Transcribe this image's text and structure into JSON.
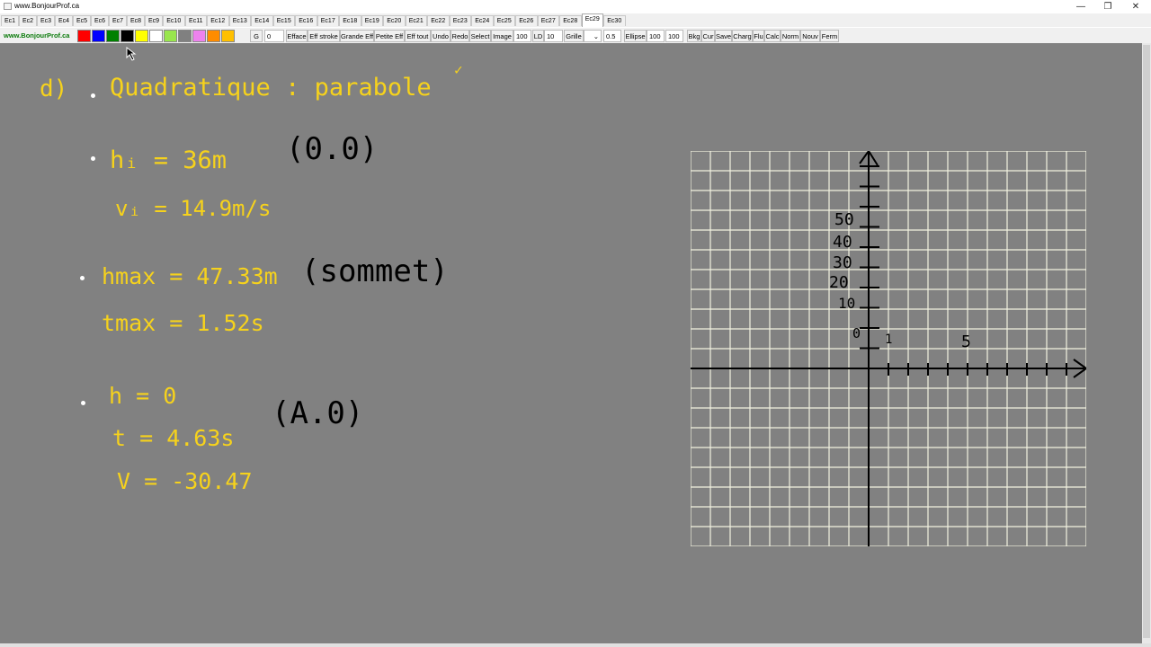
{
  "window": {
    "title": "www.BonjourProf.ca",
    "min": "—",
    "restore": "❐",
    "close": "✕"
  },
  "tabs": [
    "Ec1",
    "Ec2",
    "Ec3",
    "Ec4",
    "Ec5",
    "Ec6",
    "Ec7",
    "Ec8",
    "Ec9",
    "Ec10",
    "Ec11",
    "Ec12",
    "Ec13",
    "Ec14",
    "Ec15",
    "Ec16",
    "Ec17",
    "Ec18",
    "Ec19",
    "Ec20",
    "Ec21",
    "Ec22",
    "Ec23",
    "Ec24",
    "Ec25",
    "Ec26",
    "Ec27",
    "Ec28",
    "Ec29",
    "Ec30"
  ],
  "active_tab": "Ec29",
  "toolbar": {
    "brand": "www.BonjourProf.ca",
    "colors": [
      "#ff0000",
      "#0000ff",
      "#008000",
      "#000000",
      "#ffff00",
      "#ffffff",
      "#99e64d",
      "#808080",
      "#ee82ee",
      "#ff8c00",
      "#ffc000"
    ],
    "g_label": "G",
    "g_value": "0",
    "efface": "Efface",
    "eff_stroke": "Eff stroke",
    "grande_eff": "Grande Eff",
    "petite_eff": "Petite Eff",
    "eff_tout": "Eff tout",
    "undo": "Undo",
    "redo": "Redo",
    "select": "Select",
    "image": "Image",
    "image_value": "100",
    "ld": "LD",
    "ld_value": "10",
    "grille": "Grille",
    "grille_dropdown": "⌄",
    "grille_value": "0.5",
    "ellipse": "Ellipse",
    "ellipse_w": "100",
    "ellipse_h": "100",
    "bkg": "Bkg",
    "cur": "Cur",
    "save": "Save",
    "charg": "Charg",
    "flu": "Flu",
    "calc": "Calc",
    "norm": "Norm",
    "nouv": "Nouv",
    "ferm": "Ferm"
  },
  "notes": {
    "d_label": "d)",
    "quadratique": "Quadratique : parabole",
    "check": "✓",
    "hi": "hᵢ = 36m",
    "hi_point": "(0.0)",
    "vi": "vᵢ = 14.9m/s",
    "hmax": "hmax = 47.33m",
    "sommet": "(sommet)",
    "tmax": "tmax = 1.52s",
    "h0": "h = 0",
    "t": "t = 4.63s",
    "t_point": "(A.0)",
    "v": "V = -30.47"
  },
  "graph": {
    "y_labels": [
      "50",
      "40",
      "30",
      "20",
      "10"
    ],
    "origin": "0",
    "x_labels": [
      "1",
      "5"
    ]
  }
}
